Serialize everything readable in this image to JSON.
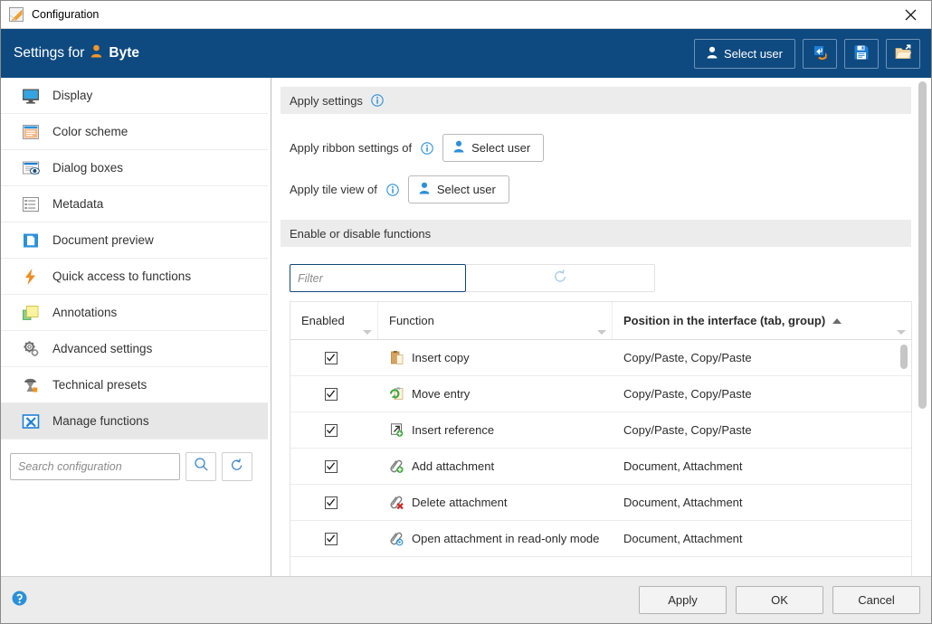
{
  "window": {
    "title": "Configuration",
    "app_icon": "config-app-icon",
    "close_icon": "close-icon"
  },
  "header": {
    "prefix_label": "Settings for",
    "user_icon": "user-icon",
    "user_name": "Byte",
    "accent_color": "#0e4a80",
    "buttons": [
      {
        "label": "Select user",
        "icon": "user-icon",
        "name": "select-user-button"
      },
      {
        "label": "",
        "icon": "import-settings-icon",
        "name": "import-settings-button"
      },
      {
        "label": "",
        "icon": "save-icon",
        "name": "save-settings-button"
      },
      {
        "label": "",
        "icon": "open-folder-icon",
        "name": "open-settings-button"
      }
    ]
  },
  "sidebar": {
    "items": [
      {
        "label": "Display",
        "icon": "monitor-icon",
        "selected": false
      },
      {
        "label": "Color scheme",
        "icon": "color-scheme-icon",
        "selected": false
      },
      {
        "label": "Dialog boxes",
        "icon": "dialog-box-icon",
        "selected": false
      },
      {
        "label": "Metadata",
        "icon": "metadata-list-icon",
        "selected": false
      },
      {
        "label": "Document preview",
        "icon": "document-preview-icon",
        "selected": false
      },
      {
        "label": "Quick access to functions",
        "icon": "lightning-bolt-icon",
        "selected": false
      },
      {
        "label": "Annotations",
        "icon": "sticky-note-icon",
        "selected": false
      },
      {
        "label": "Advanced settings",
        "icon": "gears-icon",
        "selected": false
      },
      {
        "label": "Technical presets",
        "icon": "technical-preset-icon",
        "selected": false
      },
      {
        "label": "Manage functions",
        "icon": "manage-functions-icon",
        "selected": true
      }
    ],
    "search": {
      "placeholder": "Search configuration",
      "value": "",
      "search_icon": "magnifier-icon",
      "reset_icon": "reset-icon"
    }
  },
  "main": {
    "apply_settings": {
      "title": "Apply settings",
      "info_icon": "info-icon",
      "rows": [
        {
          "label": "Apply ribbon settings of",
          "info_icon": "info-icon",
          "button_label": "Select user",
          "button_icon": "user-icon"
        },
        {
          "label": "Apply tile view of",
          "info_icon": "info-icon",
          "button_label": "Select user",
          "button_icon": "user-icon"
        }
      ]
    },
    "functions_section": {
      "title": "Enable or disable functions",
      "filter": {
        "placeholder": "Filter",
        "value": "",
        "reset_icon": "reset-icon"
      },
      "table": {
        "columns": [
          {
            "label": "Enabled",
            "sorted": false,
            "filter_icon": "caret-down-icon"
          },
          {
            "label": "Function",
            "sorted": false,
            "filter_icon": "caret-down-icon"
          },
          {
            "label": "Position in the interface (tab, group)",
            "sorted": true,
            "sort_direction": "asc",
            "filter_icon": "caret-down-icon"
          }
        ],
        "rows": [
          {
            "enabled": true,
            "icon": "insert-copy-icon",
            "function": "Insert copy",
            "position": "Copy/Paste, Copy/Paste"
          },
          {
            "enabled": true,
            "icon": "move-entry-icon",
            "function": "Move entry",
            "position": "Copy/Paste, Copy/Paste"
          },
          {
            "enabled": true,
            "icon": "insert-reference-icon",
            "function": "Insert reference",
            "position": "Copy/Paste, Copy/Paste"
          },
          {
            "enabled": true,
            "icon": "add-attachment-icon",
            "function": "Add attachment",
            "position": "Document, Attachment"
          },
          {
            "enabled": true,
            "icon": "delete-attachment-icon",
            "function": "Delete attachment",
            "position": "Document, Attachment"
          },
          {
            "enabled": true,
            "icon": "open-attachment-readonly-icon",
            "function": "Open attachment in read-only mode",
            "position": "Document, Attachment"
          }
        ]
      }
    }
  },
  "footer": {
    "help_icon": "help-icon",
    "buttons": [
      {
        "label": "Apply",
        "name": "apply-button"
      },
      {
        "label": "OK",
        "name": "ok-button"
      },
      {
        "label": "Cancel",
        "name": "cancel-button"
      }
    ]
  }
}
